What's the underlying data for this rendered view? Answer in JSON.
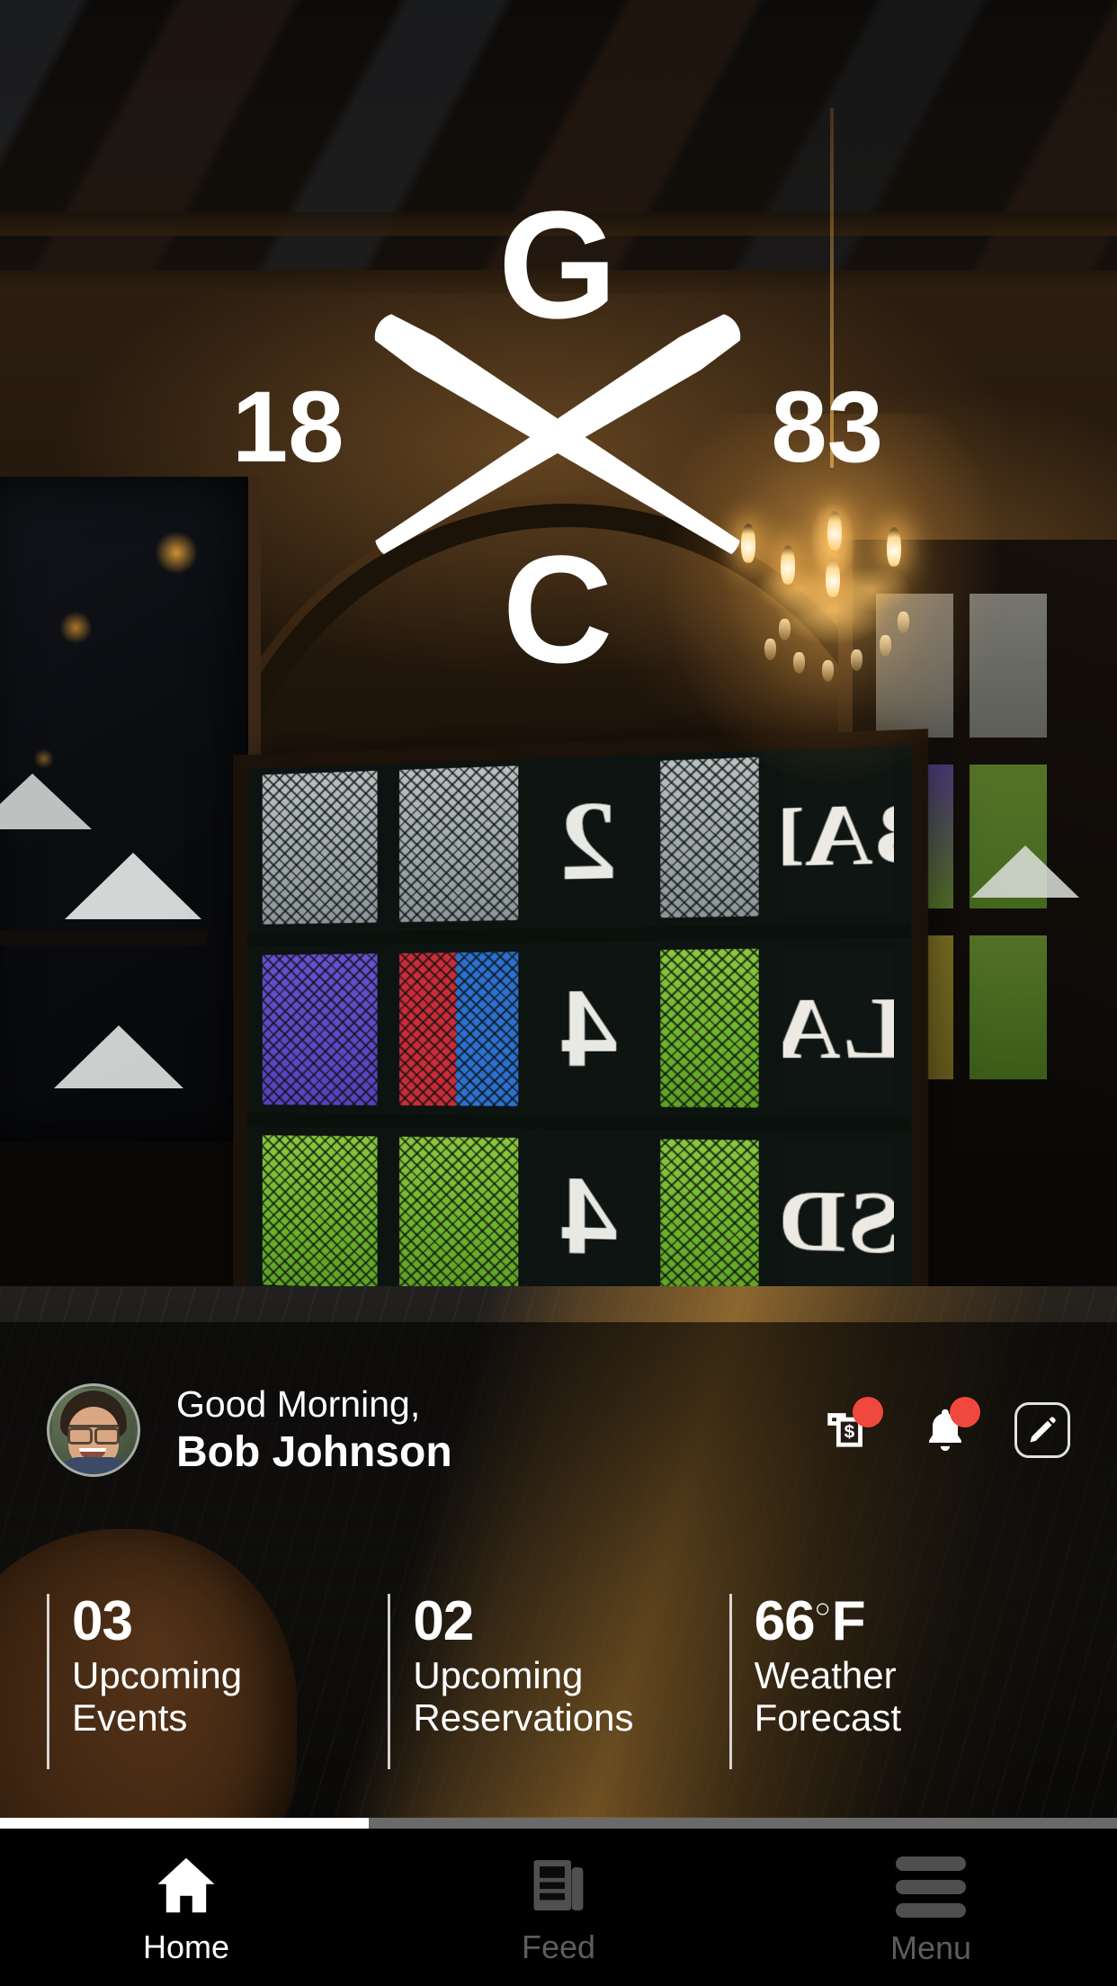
{
  "logo": {
    "top_letter": "G",
    "bottom_letter": "C",
    "year_left": "18",
    "year_right": "83",
    "icon": "crossed-baseball-bats"
  },
  "greeting": {
    "salutation": "Good Morning,",
    "user_name": "Bob Johnson",
    "avatar_alt": "user-avatar",
    "actions": [
      {
        "name": "billing-receipt-icon",
        "has_badge": true
      },
      {
        "name": "notifications-bell-icon",
        "has_badge": true
      },
      {
        "name": "edit-profile-pencil-icon",
        "has_badge": false
      }
    ],
    "badge_color": "#f1483e"
  },
  "stats": [
    {
      "value": "03",
      "label": "Upcoming\nEvents",
      "degree": "",
      "unit": ""
    },
    {
      "value": "02",
      "label": "Upcoming\nReservations",
      "degree": "",
      "unit": ""
    },
    {
      "value": "66",
      "label": "Weather\nForecast",
      "degree": "○",
      "unit": "F"
    }
  ],
  "scroll": {
    "progress_percent": 33
  },
  "nav": {
    "items": [
      {
        "label": "Home",
        "icon": "home-icon",
        "active": true
      },
      {
        "label": "Feed",
        "icon": "newspaper-icon",
        "active": false
      },
      {
        "label": "Menu",
        "icon": "hamburger-icon",
        "active": false
      }
    ],
    "active_color": "#ffffff",
    "inactive_color": "#5d5d5d",
    "background": "#000000"
  },
  "background": {
    "scene": "baseball-clubhouse-interior",
    "scoreboard": {
      "numbers": [
        "2",
        "4",
        "4"
      ],
      "teams": [
        "BAL",
        "LA",
        "SD"
      ]
    }
  }
}
